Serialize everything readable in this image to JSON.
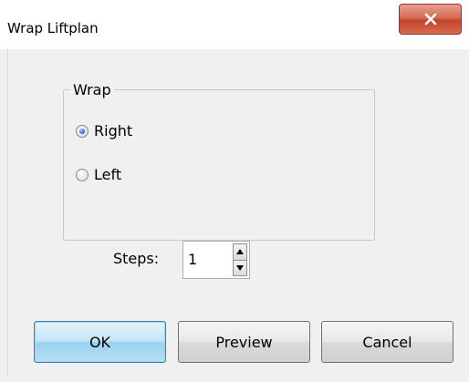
{
  "window": {
    "title": "Wrap Liftplan"
  },
  "group": {
    "legend": "Wrap",
    "options": [
      {
        "label": "Right",
        "checked": true
      },
      {
        "label": "Left",
        "checked": false
      }
    ]
  },
  "steps": {
    "label": "Steps:",
    "value": "1"
  },
  "buttons": {
    "ok": "OK",
    "preview": "Preview",
    "cancel": "Cancel"
  },
  "icons": {
    "close": "close-icon",
    "spin_up": "spin-up-icon",
    "spin_down": "spin-down-icon"
  },
  "colors": {
    "close_button": "#c84f36",
    "default_button": "#98d1ef",
    "background": "#f0f0f0"
  }
}
